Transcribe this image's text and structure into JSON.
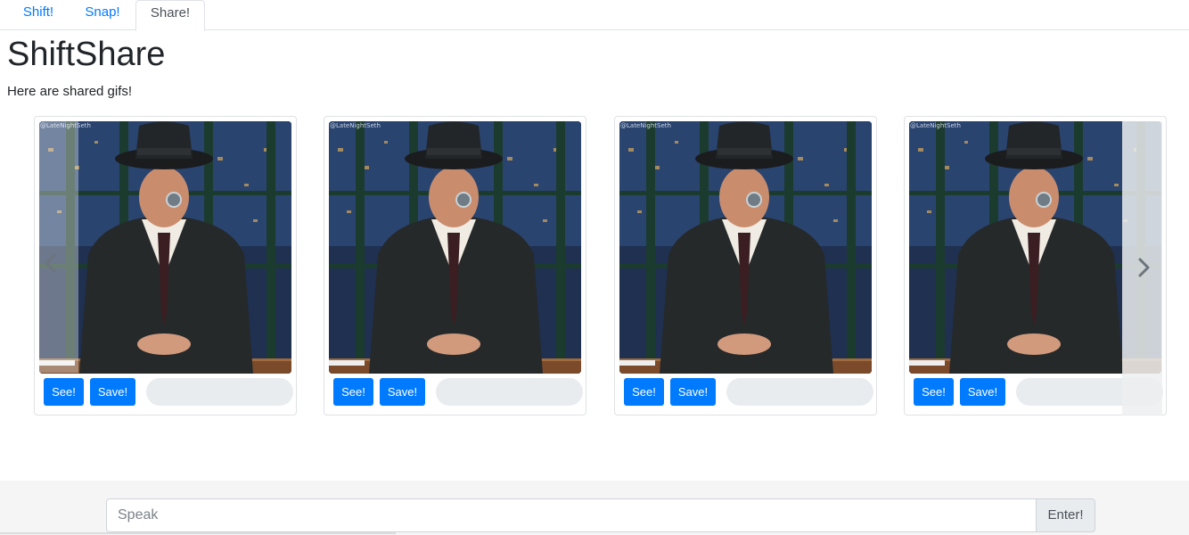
{
  "tabs": [
    {
      "label": "Shift!"
    },
    {
      "label": "Snap!"
    },
    {
      "label": "Share!"
    }
  ],
  "active_tab": "Share!",
  "page": {
    "title": "ShiftShare",
    "subtitle": "Here are shared gifs!"
  },
  "cards": [
    {
      "watermark": "@LateNightSeth",
      "see_label": "See!",
      "save_label": "Save!"
    },
    {
      "watermark": "@LateNightSeth",
      "see_label": "See!",
      "save_label": "Save!"
    },
    {
      "watermark": "@LateNightSeth",
      "see_label": "See!",
      "save_label": "Save!"
    },
    {
      "watermark": "@LateNightSeth",
      "see_label": "See!",
      "save_label": "Save!"
    }
  ],
  "carousel": {
    "prev_icon": "chevron-left-icon",
    "next_icon": "chevron-right-icon"
  },
  "footer": {
    "input_placeholder": "Speak",
    "input_value": "",
    "enter_label": "Enter!"
  },
  "colors": {
    "primary": "#007bff",
    "tab_link": "#007bff",
    "pill_bg": "#e9ecef",
    "footer_bg": "#f5f5f5"
  }
}
